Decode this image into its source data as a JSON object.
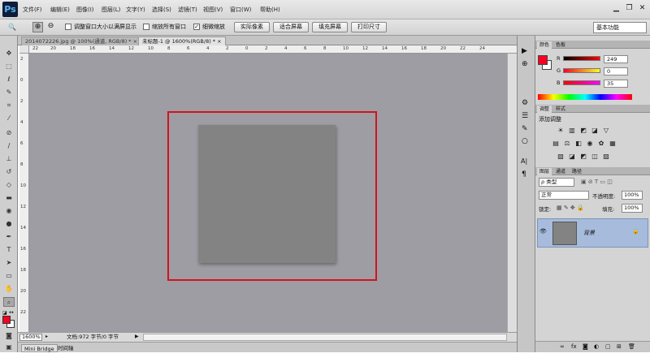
{
  "app": {
    "logo": "Ps"
  },
  "menu": [
    "文件(F)",
    "编辑(E)",
    "图像(I)",
    "图层(L)",
    "文字(Y)",
    "选择(S)",
    "滤镜(T)",
    "视图(V)",
    "窗口(W)",
    "帮助(H)"
  ],
  "window_controls": {
    "minimize": "▁",
    "restore": "❐",
    "close": "✕"
  },
  "options": {
    "tool_glyph": "🔍",
    "zoom_in": "⊕",
    "zoom_out": "⊖",
    "resize_windows_label": "调整窗口大小以满屏显示",
    "zoom_all_label": "缩放所有窗口",
    "scrubby_label": "细微缩放",
    "scrubby_checked": "✓",
    "actual_pixels": "实际像素",
    "fit_screen": "适合屏幕",
    "fill_screen": "填充屏幕",
    "print_size": "打印尺寸",
    "workspace": "基本功能"
  },
  "tabs": [
    {
      "label": "2014072226.jpg @ 100%(通道, RGB/8) *",
      "close": "×"
    },
    {
      "label": "未标题-1 @ 1600%(RGB/8) *",
      "close": "×"
    }
  ],
  "ruler_h": [
    "22",
    "20",
    "18",
    "16",
    "14",
    "12",
    "10",
    "8",
    "6",
    "4",
    "2",
    "0",
    "2",
    "4",
    "6",
    "8",
    "10",
    "12",
    "14",
    "16",
    "18",
    "20",
    "22",
    "24"
  ],
  "ruler_v": [
    "2",
    "0",
    "2",
    "4",
    "6",
    "8",
    "10",
    "12",
    "14",
    "16",
    "18",
    "20",
    "22"
  ],
  "status": {
    "zoom": "1600%",
    "doc": "文档:972 字节/0 字节"
  },
  "bottom_tabs": [
    "Mini Bridge",
    "时间轴"
  ],
  "color_panel": {
    "tabs": [
      "颜色",
      "色板"
    ],
    "channels": [
      {
        "label": "R",
        "value": "249"
      },
      {
        "label": "G",
        "value": "0"
      },
      {
        "label": "B",
        "value": "35"
      }
    ],
    "foreground": "#f90023",
    "background": "#ffffff"
  },
  "adjust_panel": {
    "tabs": [
      "调整",
      "样式"
    ],
    "title": "添加调整",
    "icons_row1": [
      "☀",
      "▥",
      "◩",
      "◪",
      "▽"
    ],
    "icons_row2": [
      "▤",
      "⚖",
      "◧",
      "◉",
      "✿",
      "▦"
    ],
    "icons_row3": [
      "▧",
      "◪",
      "◩",
      "◫",
      "▨"
    ]
  },
  "layers_panel": {
    "tabs": [
      "图层",
      "通道",
      "路径"
    ],
    "filter_placeholder": "ρ 类型",
    "blend_mode": "正常",
    "opacity_label": "不透明度:",
    "opacity": "100%",
    "lock_label": "锁定:",
    "fill_label": "填充:",
    "fill": "100%",
    "layer_name": "背景",
    "eye": "👁",
    "lock": "🔒",
    "footer_icons": [
      "∞",
      "fx",
      "◙",
      "◐",
      "▢",
      "⊞",
      "🗑"
    ]
  },
  "dock_icons": [
    "▶",
    "⊕",
    "⚙",
    "☰",
    "✎",
    "⎔",
    "A|",
    "¶"
  ],
  "colors": {
    "accent": "#d2141e",
    "canvas": "#9e9da3",
    "document": "#838383",
    "layer_selected": "#a7bcdc"
  }
}
